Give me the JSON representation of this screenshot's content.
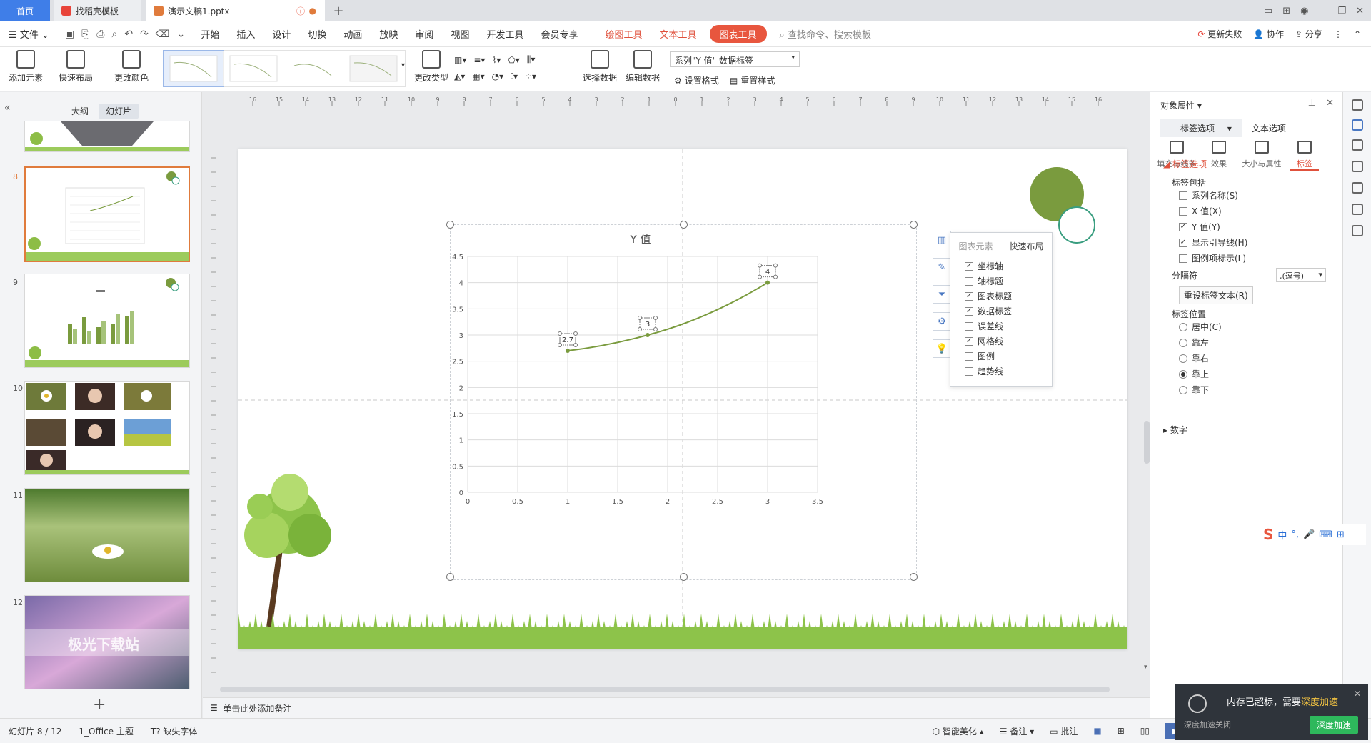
{
  "tabs": {
    "home": "首页",
    "template": "找稻壳模板",
    "doc": "演示文稿1.pptx"
  },
  "menu": {
    "file": "文件",
    "items": [
      "开始",
      "插入",
      "设计",
      "切换",
      "动画",
      "放映",
      "审阅",
      "视图",
      "开发工具",
      "会员专享"
    ],
    "tools": [
      "绘图工具",
      "文本工具"
    ],
    "active_tool": "图表工具",
    "search_placeholder": "查找命令、搜索模板",
    "right": {
      "update": "更新失败",
      "collab": "协作",
      "share": "分享"
    }
  },
  "ribbon": {
    "add_element": "添加元素",
    "quick_layout": "快速布局",
    "change_color": "更改颜色",
    "change_type": "更改类型",
    "select_data": "选择数据",
    "edit_data": "编辑数据",
    "series_selector": "系列\"Y 值\" 数据标签",
    "set_format": "设置格式",
    "reset_style": "重置样式"
  },
  "left_panel": {
    "tab_outline": "大纲",
    "tab_slides": "幻灯片",
    "slides": [
      {
        "num": "8",
        "selected": true
      },
      {
        "num": "9",
        "selected": false
      },
      {
        "num": "10",
        "selected": false
      },
      {
        "num": "11",
        "selected": false
      },
      {
        "num": "12",
        "selected": false,
        "caption": "极光下载站"
      }
    ],
    "add_slide": "+"
  },
  "chart_data": {
    "type": "line",
    "title": "Y 值",
    "x": [
      1,
      1.8,
      3
    ],
    "values": [
      2.7,
      3,
      4
    ],
    "data_labels": [
      "2.7",
      "3",
      "4"
    ],
    "xlim": [
      0,
      3.5
    ],
    "ylim": [
      0,
      4.5
    ],
    "x_ticks": [
      "0",
      "0.5",
      "1",
      "1.5",
      "2",
      "2.5",
      "3",
      "3.5"
    ],
    "y_ticks": [
      "0",
      "0.5",
      "1",
      "1.5",
      "2",
      "2.5",
      "3",
      "3.5",
      "4",
      "4.5"
    ],
    "grid": true,
    "color": "#7a9b3e"
  },
  "elements_popup": {
    "tab_elements": "图表元素",
    "tab_quick": "快速布局",
    "items": [
      {
        "label": "坐标轴",
        "checked": true
      },
      {
        "label": "轴标题",
        "checked": false
      },
      {
        "label": "图表标题",
        "checked": true
      },
      {
        "label": "数据标签",
        "checked": true
      },
      {
        "label": "误差线",
        "checked": false
      },
      {
        "label": "网格线",
        "checked": true
      },
      {
        "label": "图例",
        "checked": false
      },
      {
        "label": "趋势线",
        "checked": false
      }
    ]
  },
  "right_panel": {
    "title": "对象属性",
    "tab_label": "标签选项",
    "tab_text": "文本选项",
    "icons": [
      "填充与线条",
      "效果",
      "大小与属性",
      "标签"
    ],
    "section": "标签选项",
    "contains": "标签包括",
    "checks": [
      {
        "label": "系列名称(S)",
        "checked": false
      },
      {
        "label": "X 值(X)",
        "checked": false
      },
      {
        "label": "Y 值(Y)",
        "checked": true
      },
      {
        "label": "显示引导线(H)",
        "checked": true
      },
      {
        "label": "图例项标示(L)",
        "checked": false
      }
    ],
    "separator_label": "分隔符",
    "separator_value": ",(逗号)",
    "reset_button": "重设标签文本(R)",
    "position_label": "标签位置",
    "positions": [
      {
        "label": "居中(C)",
        "selected": false
      },
      {
        "label": "靠左",
        "selected": false
      },
      {
        "label": "靠右",
        "selected": false
      },
      {
        "label": "靠上",
        "selected": true
      },
      {
        "label": "靠下",
        "selected": false
      }
    ],
    "number_section": "数字"
  },
  "ime": {
    "lang": "中"
  },
  "notes": {
    "placeholder": "单击此处添加备注"
  },
  "status": {
    "slide_count": "幻灯片 8 / 12",
    "theme": "1_Office 主题",
    "missing_font": "缺失字体",
    "smart_beautify": "智能美化",
    "notes": "备注",
    "comments": "批注"
  },
  "notification": {
    "main_prefix": "内存已超标，需要",
    "main_highlight": "深度加速",
    "sub": "深度加速关闭",
    "cta": "深度加速"
  }
}
